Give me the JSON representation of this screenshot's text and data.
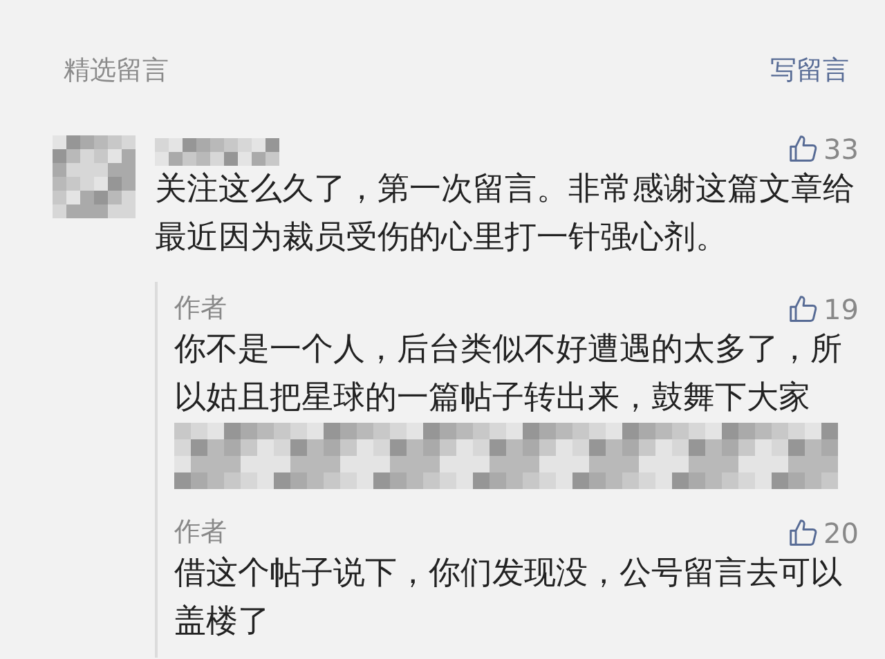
{
  "header": {
    "title": "精选留言",
    "action": "写留言"
  },
  "comment": {
    "likes": "33",
    "text": "关注这么久了，第一次留言。非常感谢这篇文章给最近因为裁员受伤的心里打一针强心剂。",
    "replies": [
      {
        "author": "作者",
        "likes": "19",
        "text": "你不是一个人，后台类似不好遭遇的太多了，所以姑且把星球的一篇帖子转出来，鼓舞下大家",
        "kind": "attachment"
      },
      {
        "author": "作者",
        "likes": "20",
        "text": "借这个帖子说下，你们发现没，公号留言去可以盖楼了",
        "kind": "text"
      }
    ]
  }
}
